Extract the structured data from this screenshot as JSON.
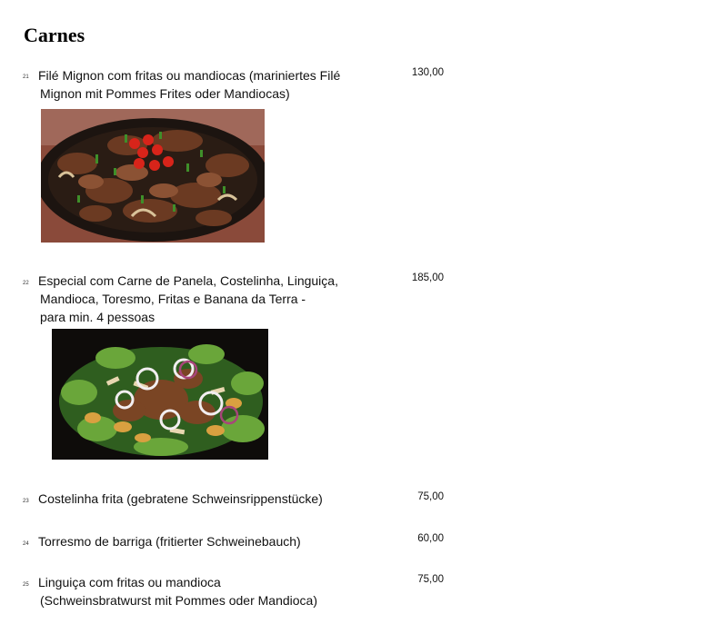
{
  "section_title": "Carnes",
  "items": [
    {
      "number": "21",
      "lines": [
        "Filé Mignon com fritas ou mandiocas (mariniertes Filé",
        "Mignon mit Pommes Frites oder Mandiocas)"
      ],
      "price": "130,00"
    },
    {
      "number": "22",
      "lines": [
        "Especial com Carne de Panela, Costelinha, Linguiça,",
        "Mandioca, Toresmo, Fritas e Banana da Terra  -",
        "para min. 4 pessoas"
      ],
      "price": "185,00"
    },
    {
      "number": "23",
      "lines": [
        "Costelinha frita (gebratene Schweinsrippenstücke)"
      ],
      "price": "75,00"
    },
    {
      "number": "24",
      "lines": [
        "Torresmo de barriga (fritierter Schweinebauch)"
      ],
      "price": "60,00"
    },
    {
      "number": "25",
      "lines": [
        "Linguiça com fritas ou mandioca",
        "(Schweinsbratwurst mit Pommes oder Mandioca)"
      ],
      "price": "75,00"
    }
  ],
  "colors": {
    "text": "#111111",
    "meat": "#6b3a22",
    "tomato": "#d8241a",
    "herb": "#3f8f2a"
  }
}
